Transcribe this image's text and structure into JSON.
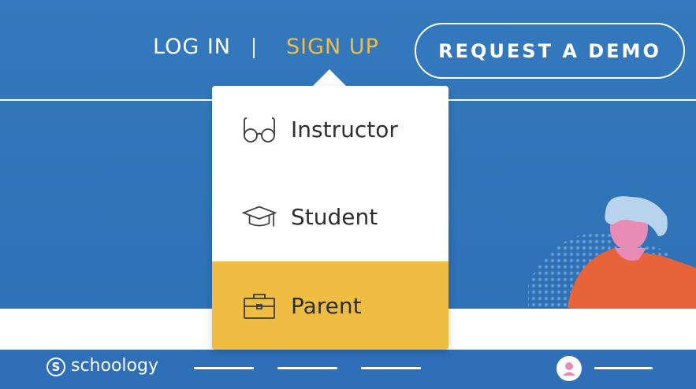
{
  "nav": {
    "login": "LOG IN",
    "separator": "|",
    "signup": "SIGN UP",
    "demo_button": "REQUEST A DEMO"
  },
  "dropdown": {
    "items": [
      {
        "label": "Instructor",
        "icon": "glasses-icon"
      },
      {
        "label": "Student",
        "icon": "graduation-cap-icon"
      },
      {
        "label": "Parent",
        "icon": "briefcase-icon"
      }
    ],
    "highlighted_index": 2
  },
  "footer": {
    "logo_mark": "S",
    "logo_text": "schoology"
  },
  "colors": {
    "background": "#2f72b8",
    "accent": "#efbd42",
    "nav_active": "#f0bd42",
    "text_dark": "#2e2e2e"
  }
}
